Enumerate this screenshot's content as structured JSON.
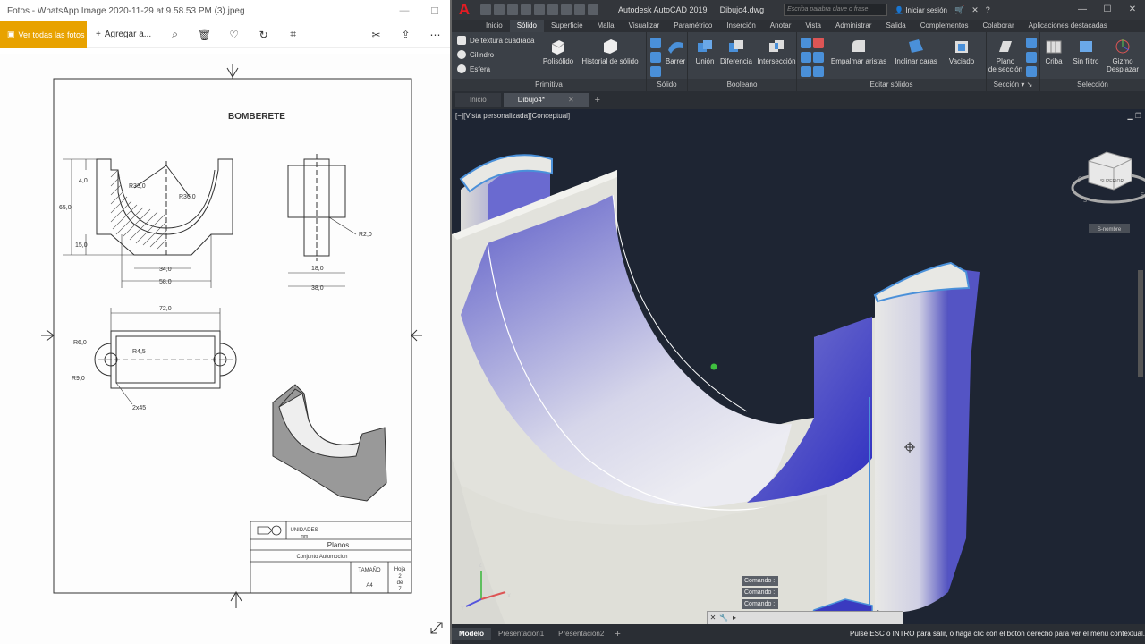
{
  "photos": {
    "title": "Fotos - WhatsApp Image 2020-11-29 at 9.58.53 PM (3).jpeg",
    "toolbar": {
      "view_all": "Ver todas las fotos",
      "add_to": "Agregar a..."
    },
    "drawing": {
      "title": "BOMBERETE",
      "dims": {
        "r33": "R33,0",
        "r36": "R36,0",
        "d4": "4,0",
        "d65": "65,0",
        "d15": "15,0",
        "d34": "34,0",
        "d58": "58,0",
        "d18": "18,0",
        "d38": "38,0",
        "r2": "R2,0",
        "d72": "72,0",
        "r6": "R6,0",
        "r45": "R4,5",
        "r9": "R9,0",
        "ch": "2x45"
      },
      "titleblock": {
        "units": "UNIDADES",
        "units_val": "mm",
        "name": "Planos",
        "subtitle": "Conjunto Automocion",
        "size_label": "TAMAÑO",
        "size_val": "A4",
        "sheet_label": "Hoja",
        "sheet_val1": "2",
        "sheet_val2": "de",
        "sheet_val3": "7"
      }
    }
  },
  "acad": {
    "app_title": "Autodesk AutoCAD 2019",
    "file_title": "Dibujo4.dwg",
    "search_placeholder": "Escriba palabra clave o frase",
    "signin": "Iniciar sesión",
    "tabs": [
      "Inicio",
      "Sólido",
      "Superficie",
      "Malla",
      "Visualizar",
      "Paramétrico",
      "Inserción",
      "Anotar",
      "Vista",
      "Administrar",
      "Salida",
      "Complementos",
      "Colaborar",
      "Aplicaciones destacadas"
    ],
    "ribbon": {
      "primitiva": {
        "title": "Primitiva",
        "items": [
          "De textura cuadrada",
          "Cilindro",
          "Esfera"
        ],
        "polisolido": "Polisólido",
        "historial": "Historial de sólido"
      },
      "solido": {
        "title": "Sólido",
        "barrer": "Barrer"
      },
      "booleano": {
        "title": "Booleano",
        "union": "Unión",
        "diferencia": "Diferencia",
        "interseccion": "Intersección"
      },
      "editar": {
        "title": "Editar sólidos",
        "empalmar": "Empalmar aristas",
        "inclinar": "Inclinar caras",
        "vaciado": "Vaciado"
      },
      "seccion": {
        "title": "Sección",
        "plano1": "Plano",
        "plano2": "de sección"
      },
      "seleccion": {
        "title": "Selección",
        "criba": "Criba",
        "sinfiltro": "Sin filtro",
        "gizmo1": "Gizmo",
        "gizmo2": "Desplazar"
      }
    },
    "doc_tabs": [
      "Inicio",
      "Dibujo4*"
    ],
    "viewport_label": "[−][Vista personalizada][Conceptual]",
    "viewcube": {
      "face": "SUPERIOR",
      "wcs": "S-nombre"
    },
    "command_lines": [
      "Comando :",
      "Comando :",
      "Comando :"
    ],
    "status_tabs": [
      "Modelo",
      "Presentación1",
      "Presentación2"
    ],
    "status_msg": "Pulse ESC o INTRO para salir, o haga clic con el botón derecho para ver el menú contextual.",
    "colors": {
      "accent_blue": "#4a90d9",
      "solid_face": "#e2e2dc",
      "inner_blue": "#3f3fc8",
      "background": "#1e2533"
    }
  }
}
